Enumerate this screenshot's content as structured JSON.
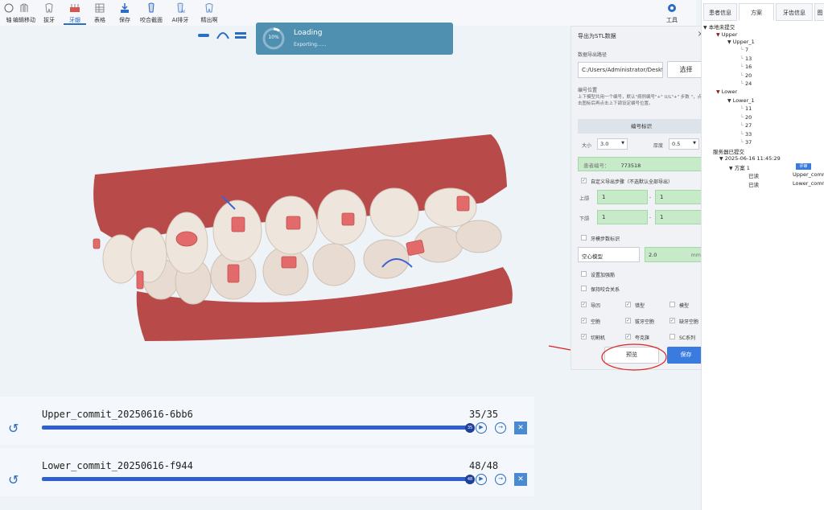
{
  "toolbar": {
    "items": [
      {
        "label": "轴",
        "name": "axis"
      },
      {
        "label": "编辑移动",
        "name": "edit-move"
      },
      {
        "label": "拔牙",
        "name": "extract"
      },
      {
        "label": "牙龈",
        "name": "gingiva"
      },
      {
        "label": "表格",
        "name": "table"
      },
      {
        "label": "保存",
        "name": "save"
      },
      {
        "label": "咬合截面",
        "name": "occlusal-section"
      },
      {
        "label": "AI排牙",
        "name": "ai-arrange"
      },
      {
        "label": "精出啊",
        "name": "export"
      }
    ],
    "tools_label": "工具"
  },
  "loading": {
    "title": "Loading",
    "subtitle": "Exporting......",
    "percent": "10%"
  },
  "export_panel": {
    "title": "导出为STL数据",
    "path_label": "数据导出路径",
    "path_value": "C:/Users/Administrator/Deskto",
    "select_button": "选择",
    "number_position_label": "编号位置",
    "number_position_desc": "上下模型共用一个编号，默认\"病例编号\"+\" U/L\"+\" 步数 \"，点击图标后再点击上下颌设定编号位置。",
    "number_mark_header": "编号标识",
    "size_label": "大小",
    "size_value": "3.0",
    "thickness_label": "厚度",
    "thickness_value": "0.5",
    "patient_no_label": "患者编号：",
    "patient_no_value": "773518",
    "custom_steps_label": "自定义导出步骤（不选默认全部导出）",
    "upper_label": "上颌",
    "upper_from": "1",
    "upper_to": "1",
    "lower_label": "下颌",
    "lower_from": "1",
    "lower_to": "1",
    "dash": "-",
    "step_mark_label": "牙模步数标识",
    "hollow_label": "空心模型",
    "hollow_value": "2.0",
    "hollow_unit": "mm",
    "reinforce_label": "设置加强筋",
    "occlusion_label": "保持咬合关系",
    "options": [
      {
        "label": "导凹",
        "checked": true
      },
      {
        "label": "错型",
        "checked": true
      },
      {
        "label": "模型",
        "checked": false
      },
      {
        "label": "空胞",
        "checked": true
      },
      {
        "label": "拔牙空胞",
        "checked": true
      },
      {
        "label": "缺牙空胞",
        "checked": true
      },
      {
        "label": "切割机",
        "checked": true
      },
      {
        "label": "夸克旗",
        "checked": true
      },
      {
        "label": "SC系列",
        "checked": false
      }
    ],
    "preview_button": "预览",
    "save_button": "保存"
  },
  "right_panel": {
    "tabs": [
      "患者信息",
      "方案",
      "牙齿信息",
      "图"
    ],
    "local_uncommitted": "本地未提交",
    "upper": "Upper",
    "upper_1": "Upper_1",
    "upper_steps": [
      "7",
      "13",
      "16",
      "20",
      "24"
    ],
    "lower": "Lower",
    "lower_1": "Lower_1",
    "lower_steps": [
      "11",
      "20",
      "27",
      "33",
      "37"
    ],
    "server_committed": "服务器已提交",
    "commit_time": "2025-06-16 11:45:29",
    "review_badge": "评审",
    "plan": "方案 1",
    "read1": "已读",
    "file1": "Upper_commi",
    "read2": "已读",
    "file2": "Lower_commi"
  },
  "progress": [
    {
      "name": "Upper_commit_20250616-6bb6",
      "count": "35/35",
      "knob": "35",
      "fraction": 1.0
    },
    {
      "name": "Lower_commit_20250616-f944",
      "count": "48/48",
      "knob": "48",
      "fraction": 1.0
    }
  ],
  "colors": {
    "accent": "#2b6cc4",
    "loading_bg": "#4f8fb0",
    "gum": "#b84a4a",
    "attachment": "#e36a6a",
    "green_field": "#c7ebc9",
    "annotation": "#e02020"
  }
}
